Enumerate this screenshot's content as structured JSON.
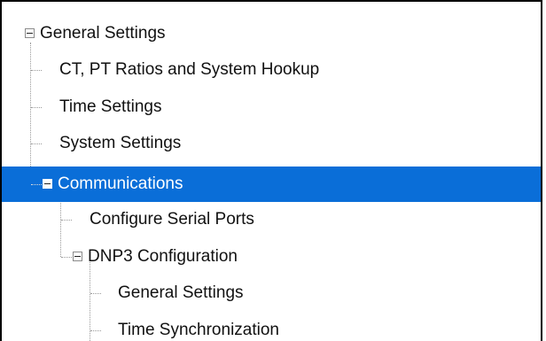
{
  "tree": {
    "root_label": "General Settings",
    "items": {
      "ct_pt": "CT, PT Ratios and System Hookup",
      "time_settings": "Time Settings",
      "system_settings": "System Settings",
      "communications": "Communications",
      "configure_serial_ports": "Configure Serial Ports",
      "dnp3_configuration": "DNP3 Configuration",
      "dnp3_general_settings": "General Settings",
      "time_synchronization": "Time Synchronization"
    },
    "selected_item": "Communications",
    "colors": {
      "selection": "#0a6ed8",
      "text": "#111111",
      "selected_text": "#ffffff",
      "connector": "#9a9a9a"
    },
    "icons": {
      "expanded": "minus-box-icon"
    }
  }
}
